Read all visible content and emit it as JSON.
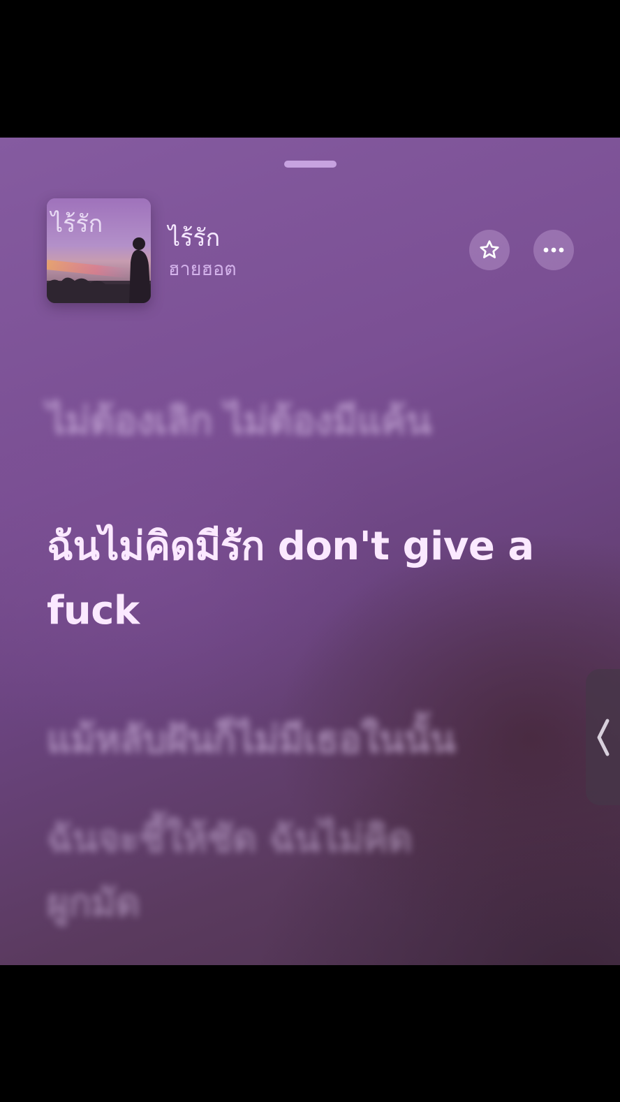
{
  "app": {
    "screen": "now-playing-lyrics"
  },
  "track": {
    "title": "ไร้รัก",
    "artist": "ฮายฮอต",
    "artwork_text": "ไร้รัก"
  },
  "controls": {
    "favorite_icon": "star-outline-icon",
    "more_icon": "ellipsis-icon",
    "side_tab_icon": "chevron-left-icon"
  },
  "lyrics": {
    "previous_faint": "",
    "previous": "ไม่ต้องเลิก ไม่ต้องมีแค้น",
    "current": "ฉันไม่คิดมีรัก don't give a fuck",
    "next": "แม้หลับฝันก็ไม่มีเธอในนั้น",
    "next_after": "ฉันจะชี้ให้ชัด ฉันไม่คิดผูกมัด"
  },
  "colors": {
    "background_top": "#855ba0",
    "background_bottom": "#4e3350",
    "active_lyric": "#fbe9ff",
    "grabber": "#c7a2e0"
  }
}
